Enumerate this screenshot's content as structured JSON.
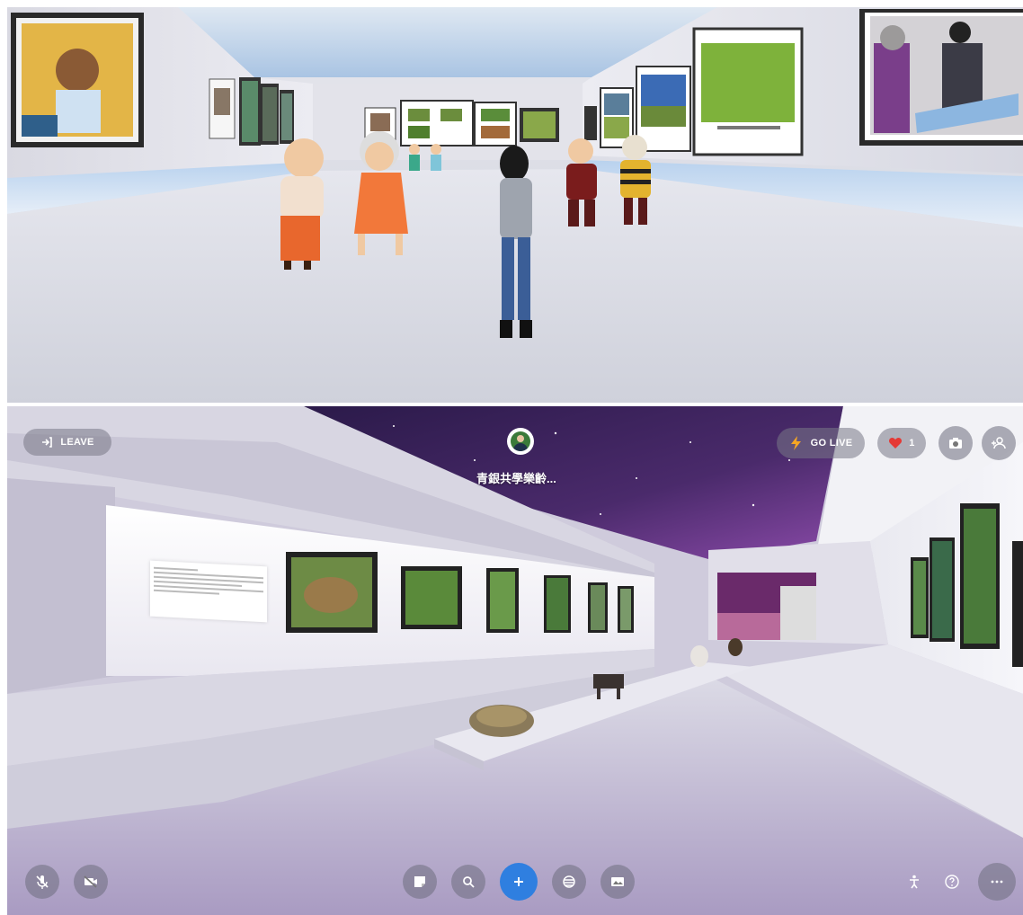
{
  "toolbar": {
    "leave_label": "LEAVE",
    "room_title": "青銀共學樂齡...",
    "go_live_label": "GO LIVE",
    "likes_count": "1"
  },
  "icons": {
    "leave": "exit-icon",
    "go_live": "lightning-icon",
    "likes": "heart-icon",
    "camera": "camera-icon",
    "invite": "add-person-icon",
    "mic": "mic-muted-icon",
    "video": "video-off-icon",
    "notes": "sticky-note-icon",
    "search": "search-icon",
    "add": "plus-icon",
    "emote": "wind-icon",
    "share_screen": "image-icon",
    "accessibility": "person-icon",
    "help": "question-icon",
    "more": "more-icon"
  },
  "colors": {
    "accent": "#2f7fe0",
    "heart": "#e53935",
    "lightning": "#f5a623"
  }
}
